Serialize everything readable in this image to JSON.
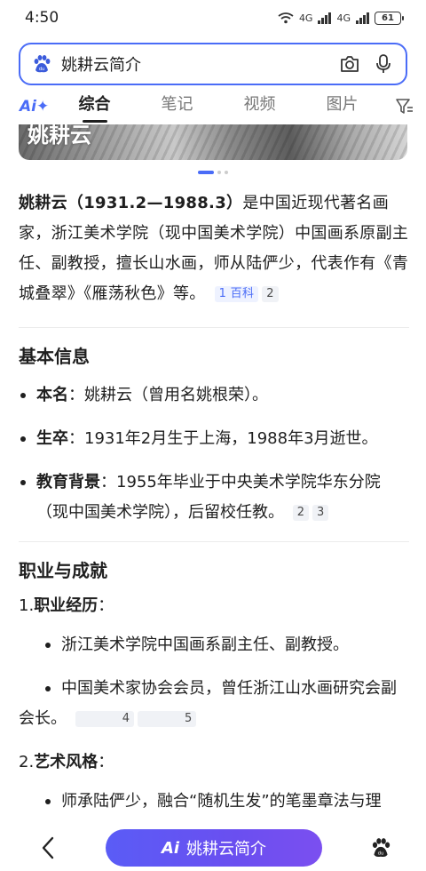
{
  "status_bar": {
    "time": "4:50",
    "signal_1": "4G",
    "signal_2": "4G",
    "battery": "61"
  },
  "search": {
    "query": "姚耕云简介"
  },
  "tabs": {
    "ai_label": "Ai✦",
    "items": [
      {
        "label": "综合",
        "active": true
      },
      {
        "label": "笔记",
        "active": false
      },
      {
        "label": "视频",
        "active": false
      },
      {
        "label": "图片",
        "active": false
      }
    ],
    "filter_icon": "filter-icon"
  },
  "banner": {
    "caption": "姚耕云"
  },
  "intro": {
    "name_span": "姚耕云（1931.2—1988.3）",
    "text": "是中国近现代著名画家，浙江美术学院（现中国美术学院）中国画系原副主任、副教授，擅长山水画，师从陆俨少，代表作有《青城叠翠》《雁荡秋色》等。",
    "cite_source": "1 百科",
    "cite_2": "2"
  },
  "basic_info": {
    "title": "基本信息",
    "items": [
      {
        "key": "本名",
        "value": "：姚耕云（曾用名姚根荣）。",
        "cites": []
      },
      {
        "key": "生卒",
        "value": "：1931年2月生于上海，1988年3月逝世。",
        "cites": []
      },
      {
        "key": "教育背景",
        "value": "：1955年毕业于中央美术学院华东分院（现中国美术学院），后留校任教。",
        "cites": [
          "2",
          "3"
        ]
      }
    ]
  },
  "career": {
    "title": "职业与成就",
    "sections": [
      {
        "number": "1.",
        "key": "职业经历",
        "colon": "：",
        "bullets": [
          {
            "text": "浙江美术学院中国画系副主任、副教授。",
            "cites": []
          },
          {
            "text": "中国美术家协会会员，曾任浙江山水画研究会副会长。",
            "cites": [
              "4",
              "5"
            ]
          }
        ]
      },
      {
        "number": "2.",
        "key": "艺术风格",
        "colon": "：",
        "bullets": [
          {
            "text": "师承陆俨少，融合“随机生发”的笔墨章法与理",
            "cites": []
          }
        ]
      }
    ]
  },
  "bottom_bar": {
    "ai_mark": "Ai",
    "ai_label": "姚耕云简介"
  },
  "colors": {
    "accent": "#4a6cf7",
    "pill_start": "#5a5cf6",
    "pill_end": "#7b4ff0"
  }
}
